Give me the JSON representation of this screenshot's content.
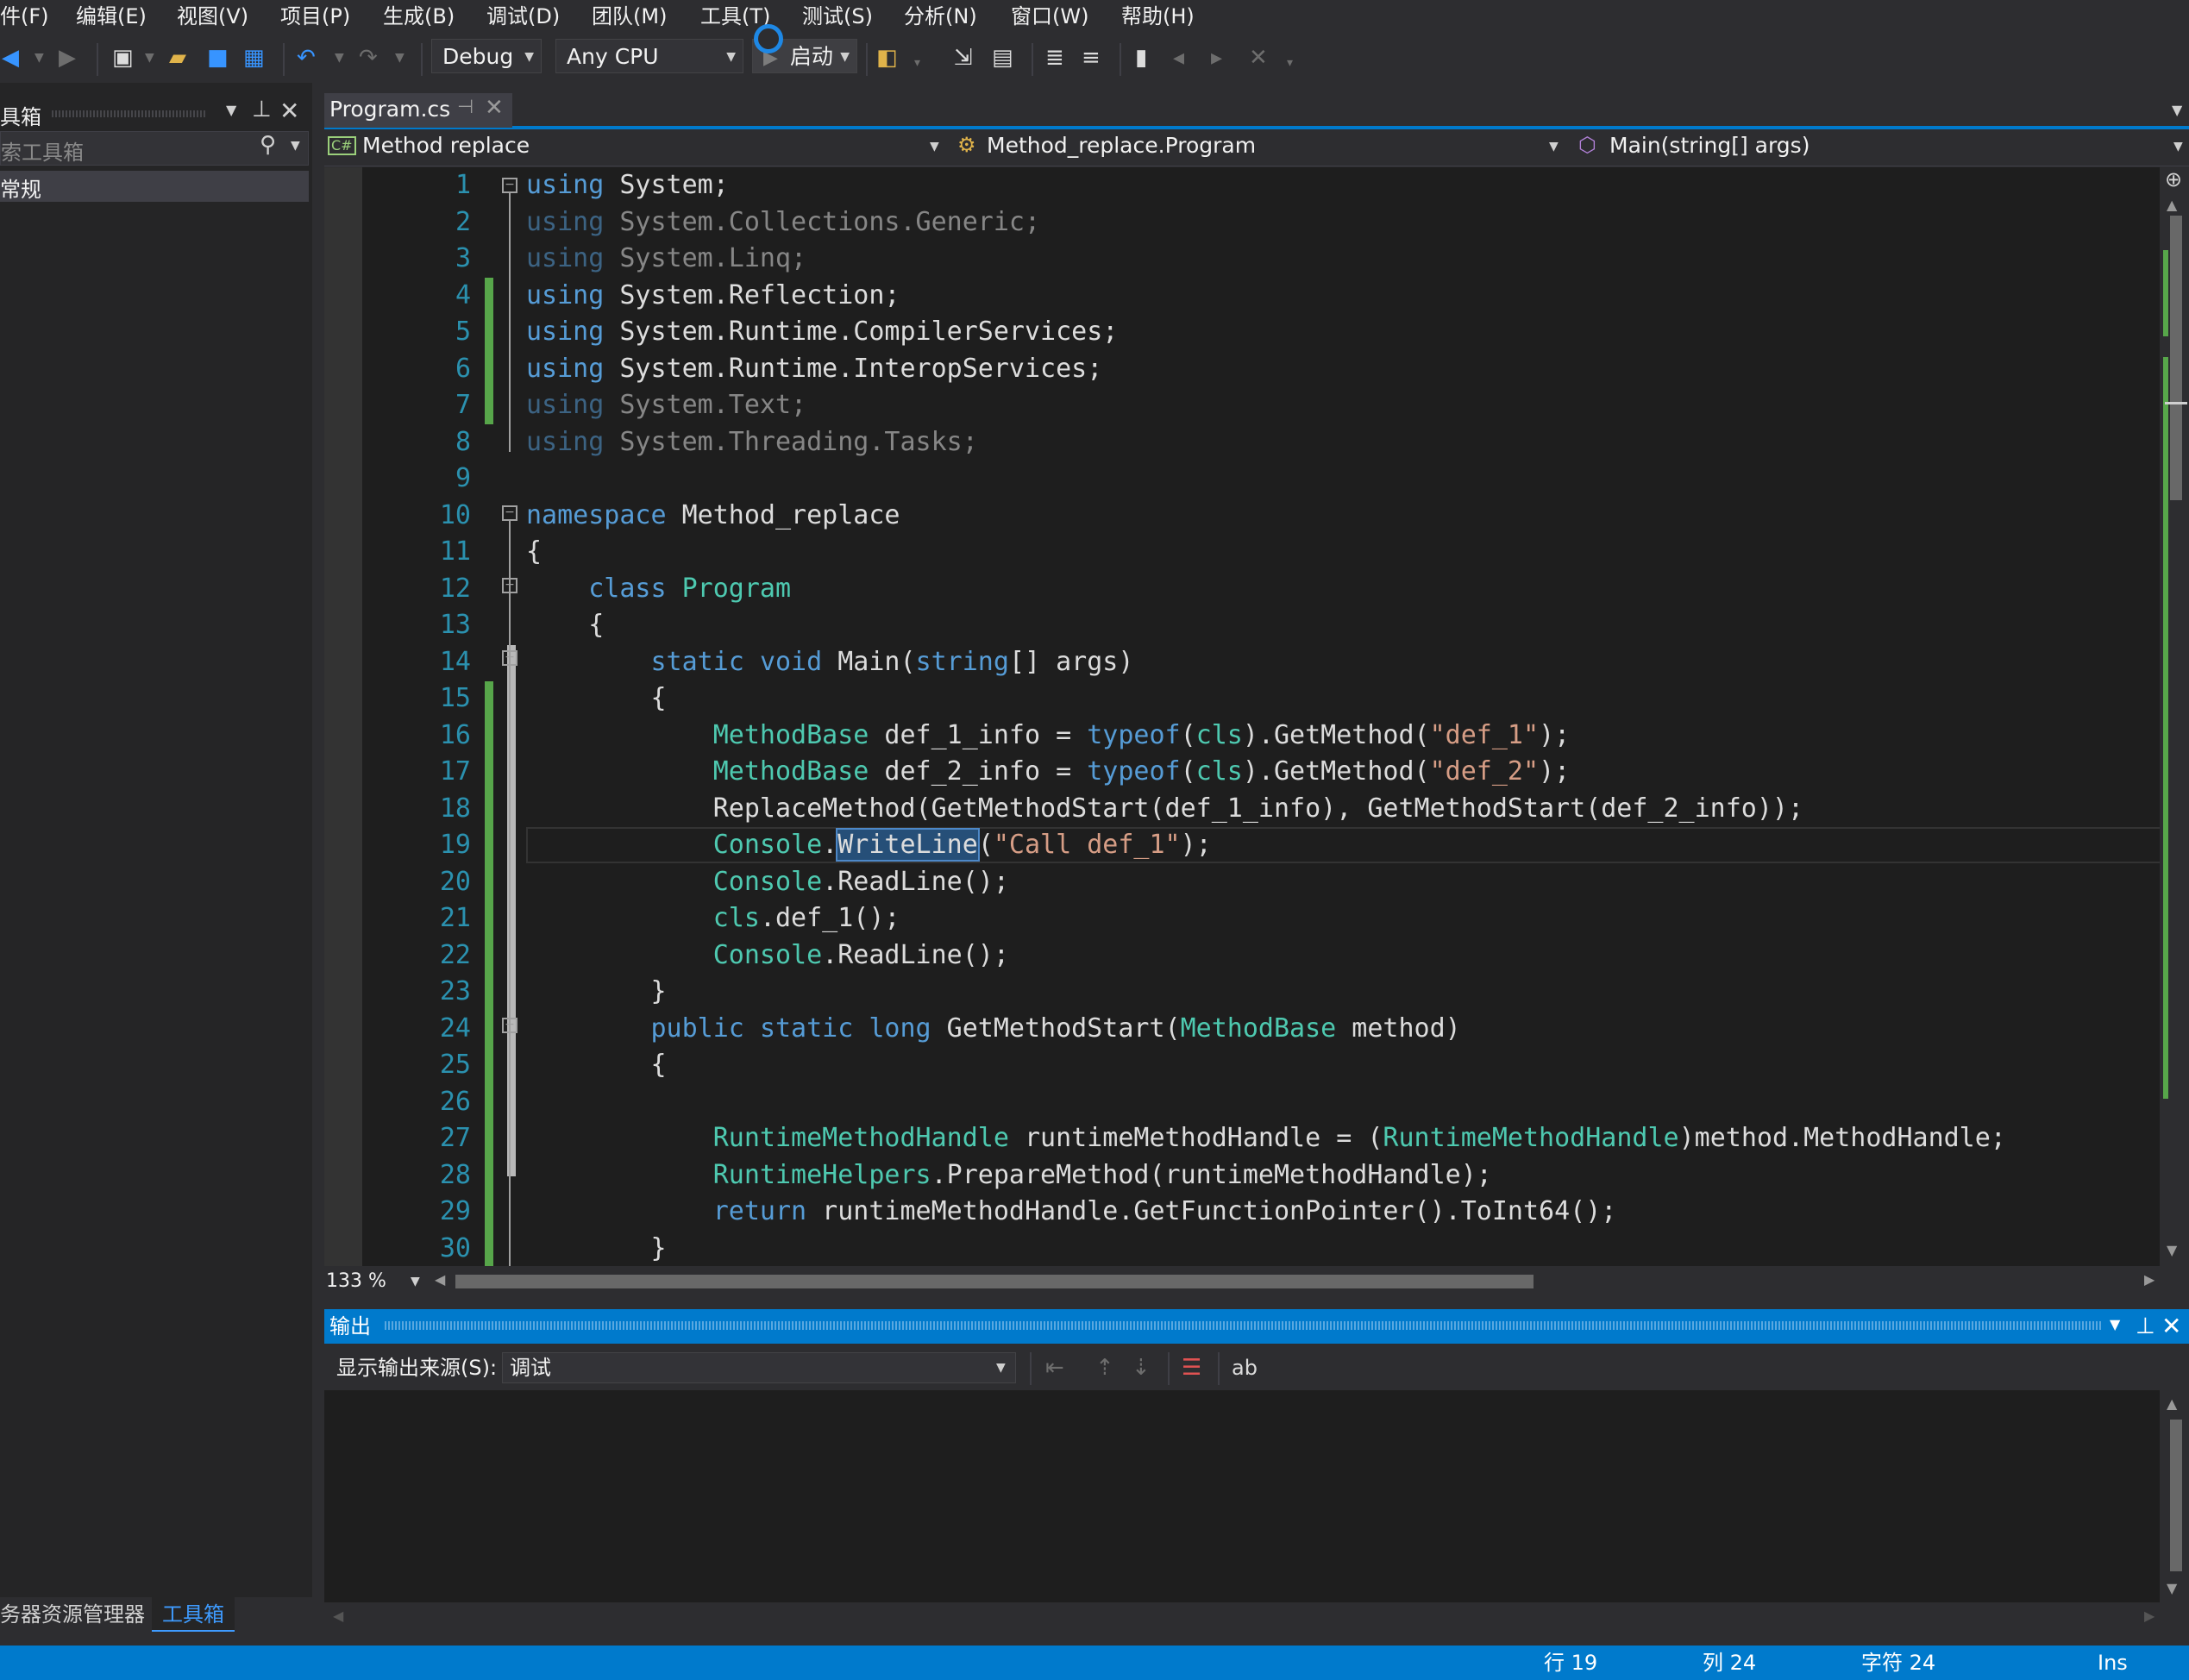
{
  "menu": [
    "件(F)",
    "编辑(E)",
    "视图(V)",
    "项目(P)",
    "生成(B)",
    "调试(D)",
    "团队(M)",
    "工具(T)",
    "测试(S)",
    "分析(N)",
    "窗口(W)",
    "帮助(H)"
  ],
  "toolbar": {
    "config": "Debug",
    "platform": "Any CPU",
    "start_label": "启动"
  },
  "toolbox": {
    "title": "具箱",
    "search_placeholder": "索工具箱",
    "group": "常规"
  },
  "editor": {
    "tab_title": "Program.cs",
    "nav_project": "Method replace",
    "nav_class": "Method_replace.Program",
    "nav_member": "Main(string[] args)",
    "zoom": "133 %",
    "lines": [
      {
        "n": "1",
        "t": "using System;"
      },
      {
        "n": "2",
        "t": "using System.Collections.Generic;"
      },
      {
        "n": "3",
        "t": "using System.Linq;"
      },
      {
        "n": "4",
        "t": "using System.Reflection;"
      },
      {
        "n": "5",
        "t": "using System.Runtime.CompilerServices;"
      },
      {
        "n": "6",
        "t": "using System.Runtime.InteropServices;"
      },
      {
        "n": "7",
        "t": "using System.Text;"
      },
      {
        "n": "8",
        "t": "using System.Threading.Tasks;"
      },
      {
        "n": "9",
        "t": ""
      },
      {
        "n": "10",
        "t": "namespace Method_replace"
      },
      {
        "n": "11",
        "t": "{"
      },
      {
        "n": "12",
        "t": "    class Program"
      },
      {
        "n": "13",
        "t": "    {"
      },
      {
        "n": "14",
        "t": "        static void Main(string[] args)"
      },
      {
        "n": "15",
        "t": "        {"
      },
      {
        "n": "16",
        "t": "            MethodBase def_1_info = typeof(cls).GetMethod(\"def_1\");"
      },
      {
        "n": "17",
        "t": "            MethodBase def_2_info = typeof(cls).GetMethod(\"def_2\");"
      },
      {
        "n": "18",
        "t": "            ReplaceMethod(GetMethodStart(def_1_info), GetMethodStart(def_2_info));"
      },
      {
        "n": "19",
        "t": "            Console.WriteLine(\"Call def_1\");"
      },
      {
        "n": "20",
        "t": "            Console.ReadLine();"
      },
      {
        "n": "21",
        "t": "            cls.def_1();"
      },
      {
        "n": "22",
        "t": "            Console.ReadLine();"
      },
      {
        "n": "23",
        "t": "        }"
      },
      {
        "n": "24",
        "t": "        public static long GetMethodStart(MethodBase method)"
      },
      {
        "n": "25",
        "t": "        {"
      },
      {
        "n": "26",
        "t": ""
      },
      {
        "n": "27",
        "t": "            RuntimeMethodHandle runtimeMethodHandle = (RuntimeMethodHandle)method.MethodHandle;"
      },
      {
        "n": "28",
        "t": "            RuntimeHelpers.PrepareMethod(runtimeMethodHandle);"
      },
      {
        "n": "29",
        "t": "            return runtimeMethodHandle.GetFunctionPointer().ToInt64();"
      },
      {
        "n": "30",
        "t": "        }"
      }
    ]
  },
  "output": {
    "title": "输出",
    "source_label": "显示输出来源(S):",
    "source_value": "调试"
  },
  "bottom_tabs": [
    "务器资源管理器",
    "工具箱"
  ],
  "status": {
    "line": "行 19",
    "col": "列 24",
    "char": "字符 24",
    "mode": "Ins"
  }
}
